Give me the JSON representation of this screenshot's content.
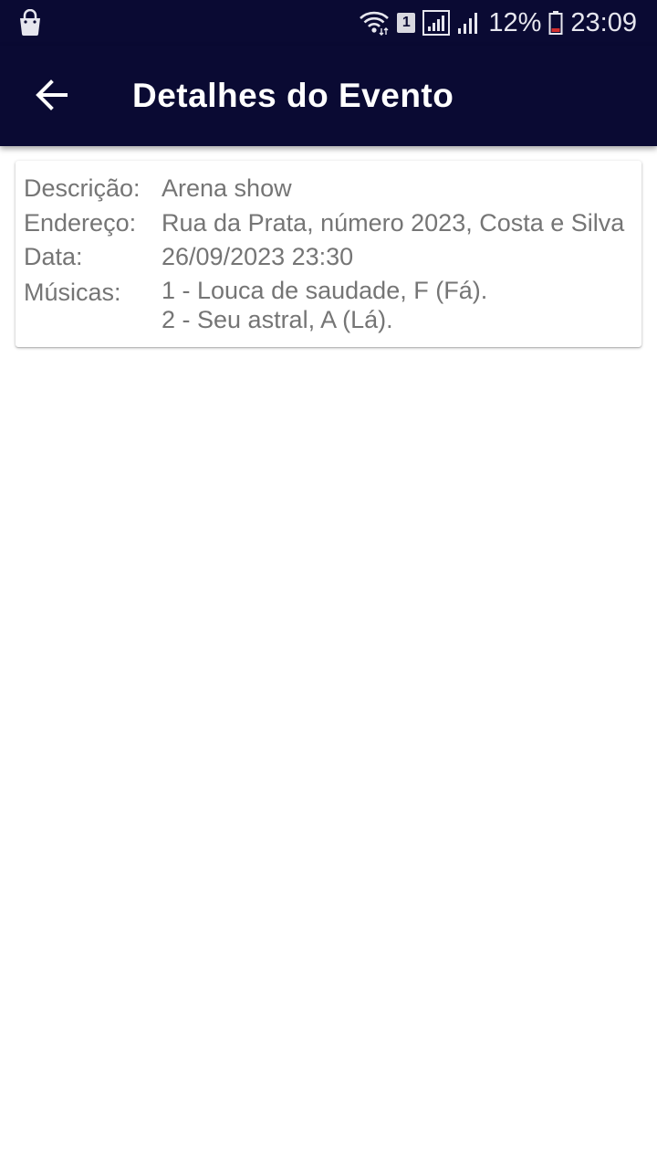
{
  "status_bar": {
    "battery_percent": "12%",
    "time": "23:09",
    "sim_badge": "1",
    "icons": [
      "shopping-bag-icon",
      "wifi-icon",
      "sim-1-icon",
      "signal-icon",
      "signal-2-icon",
      "battery-icon"
    ]
  },
  "appbar": {
    "title": "Detalhes do Evento",
    "back_icon": "arrow-back-icon"
  },
  "event": {
    "descricao_label": "Descrição:",
    "descricao_value": "Arena show",
    "endereco_label": "Endereço:",
    "endereco_value": "Rua da Prata, número 2023, Costa e Silva",
    "data_label": "Data:",
    "data_value": "26/09/2023 23:30",
    "musicas_label": "Músicas:",
    "musicas": [
      "1 - Louca de saudade, F (Fá).",
      "2 - Seu astral, A (Lá)."
    ]
  },
  "colors": {
    "appbar_bg": "#0a0a33",
    "text_gray": "#757575",
    "battery_low": "#d32f2f"
  }
}
